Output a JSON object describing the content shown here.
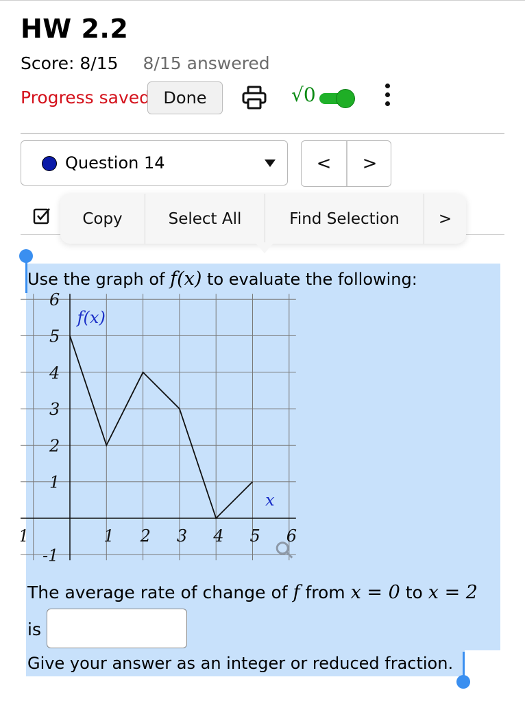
{
  "header": {
    "title": "HW 2.2",
    "score": "Score: 8/15",
    "answered": "8/15 answered",
    "progress_status": "Progress saved",
    "done_label": "Done",
    "math_toggle_label": "√0",
    "print_icon": "printer-icon",
    "more_icon": "kebab-menu-icon"
  },
  "question_nav": {
    "selected": "Question 14",
    "prev_label": "<",
    "next_label": ">"
  },
  "context_menu": {
    "items": [
      "Copy",
      "Select All",
      "Find Selection"
    ],
    "more_label": ">"
  },
  "question": {
    "prompt_before": "Use the graph of ",
    "prompt_math": "f(x)",
    "prompt_after": " to evaluate the following:",
    "rate_text_1": "The average rate of change of ",
    "rate_f": "f",
    "rate_text_2": " from ",
    "rate_eq1": "x = 0",
    "rate_text_3": " to ",
    "rate_eq2": "x = 2",
    "is_label": "is",
    "answer_value": "",
    "hint": "Give your answer as an integer or reduced fraction."
  },
  "chart_data": {
    "type": "line",
    "function_label": "f(x)",
    "xlabel": "x",
    "xlim": [
      -1,
      6
    ],
    "ylim": [
      -1,
      6
    ],
    "x_ticks": [
      "-1",
      "1",
      "2",
      "3",
      "4",
      "5",
      "6"
    ],
    "y_ticks": [
      "-1",
      "1",
      "2",
      "3",
      "4",
      "5",
      "6"
    ],
    "grid": true,
    "series": [
      {
        "x": [
          0,
          1,
          2,
          3,
          4,
          5
        ],
        "y": [
          5,
          2,
          4,
          3,
          0,
          1
        ]
      }
    ],
    "colors": {
      "curve": "#111111",
      "label": "#1b2fc7",
      "grid": "#7a7a7a"
    }
  }
}
